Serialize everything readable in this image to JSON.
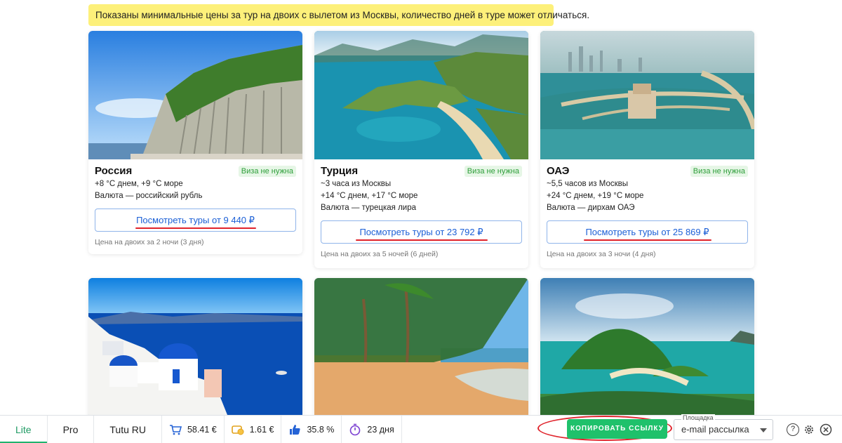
{
  "notice": "Показаны минимальные цены за тур на двоих с вылетом из Москвы, количество дней в туре может отличаться.",
  "cards": [
    {
      "title": "Россия",
      "visa": "Виза не нужна",
      "lines": [
        "+8 °С днем, +9 °С море",
        "Валюта — российский рубль"
      ],
      "button": "Посмотреть туры от 9 440 ₽",
      "note": "Цена на двоих за 2 ночи (3 дня)"
    },
    {
      "title": "Турция",
      "visa": "Виза не нужна",
      "lines": [
        "~3 часа из Москвы",
        "+14 °С днем, +17 °С море",
        "Валюта — турецкая лира"
      ],
      "button": "Посмотреть туры от 23 792 ₽",
      "note": "Цена на двоих за 5 ночей (6 дней)"
    },
    {
      "title": "ОАЭ",
      "visa": "Виза не нужна",
      "lines": [
        "~5,5 часов из Москвы",
        "+24 °С днем, +19 °С море",
        "Валюта — дирхам ОАЭ"
      ],
      "button": "Посмотреть туры от 25 869 ₽",
      "note": "Цена на двоих за 3 ночи (4 дня)"
    }
  ],
  "toolbar": {
    "tabs": [
      "Lite",
      "Pro",
      "Tutu RU"
    ],
    "stats": [
      {
        "icon": "cart-icon",
        "value": "58.41 €"
      },
      {
        "icon": "coins-icon",
        "value": "1.61 €"
      },
      {
        "icon": "thumbs-up-icon",
        "value": "35.8 %"
      },
      {
        "icon": "timer-icon",
        "value": "23 дня"
      }
    ],
    "copy_label": "КОПИРОВАТЬ ССЫЛКУ",
    "platform_label": "Площадка",
    "platform_value": "e-mail рассылка",
    "help": "?"
  },
  "colors": {
    "accent_green": "#1fc16b",
    "link_blue": "#1b5fd6",
    "highlight_red": "#e0232b",
    "notice_yellow": "#fdf07a"
  }
}
